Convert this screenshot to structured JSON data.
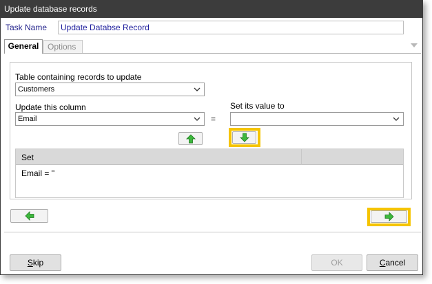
{
  "window": {
    "title": "Update database records"
  },
  "task": {
    "label": "Task Name",
    "value": "Update Databse Record"
  },
  "tabs": [
    {
      "label": "General"
    },
    {
      "label": "Options"
    }
  ],
  "general": {
    "table_label": "Table containing records to update",
    "table_value": "Customers",
    "column_label": "Update this column",
    "column_value": "Email",
    "equals": "=",
    "value_label": "Set its value to",
    "value_value": "",
    "grid": {
      "columns": [
        "Set",
        ""
      ],
      "rows": [
        "Email = ''"
      ]
    }
  },
  "footer": {
    "skip_prefix": "S",
    "skip_rest": "kip",
    "ok_label": "OK",
    "cancel_prefix": "C",
    "cancel_rest": "ancel"
  },
  "icons": {
    "up_arrow": "arrow-up-icon",
    "down_arrow": "arrow-down-icon",
    "back_arrow": "arrow-left-icon",
    "next_arrow": "arrow-right-icon",
    "dropdown": "chevron-down-icon"
  },
  "colors": {
    "titlebar": "#3c3c3c",
    "arrow_green": "#3db83d",
    "highlight": "#f5c400",
    "task_text": "#1c1c9c"
  }
}
